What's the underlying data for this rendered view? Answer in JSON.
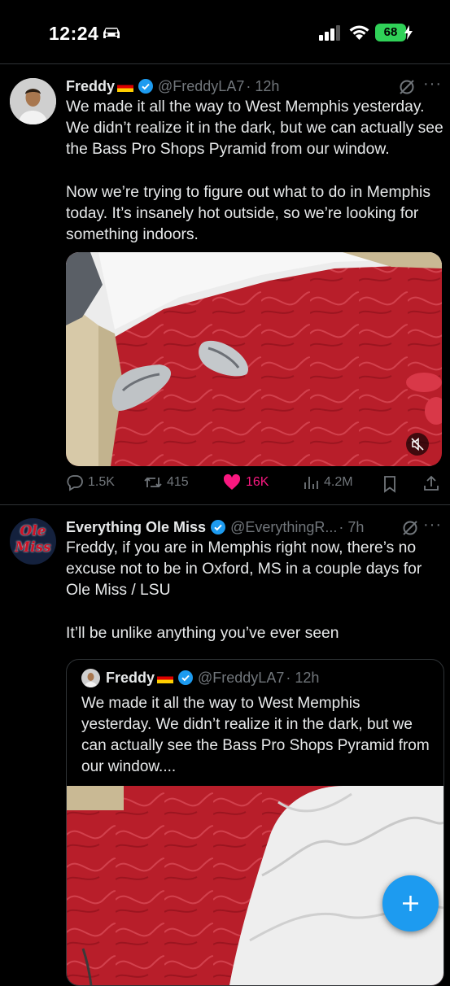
{
  "status_bar": {
    "time": "12:24",
    "battery": "68",
    "icons": [
      "car-icon",
      "cellular-signal-icon",
      "wifi-icon",
      "charging-bolt-icon"
    ]
  },
  "tweets": [
    {
      "name": "Freddy",
      "handle": "@FreddyLA7",
      "time": "· 12h",
      "text": "We made it all the way to West Memphis yesterday. We didn’t realize it in the dark, but we can actually see the Bass Pro Shops Pyramid from our window.\n\nNow we’re trying to figure out what to do in Memphis today. It’s insanely hot outside, so we’re looking for something indoors.",
      "media_icon": "muted-speaker-icon",
      "stats": {
        "replies": "1.5K",
        "reposts": "415",
        "likes": "16K",
        "views": "4.2M"
      }
    },
    {
      "name": "Everything Ole Miss",
      "handle": "@EverythingR...",
      "time": "· 7h",
      "text": "Freddy, if you are in Memphis right now, there’s no excuse not to be in Oxford, MS in a couple days for Ole Miss / LSU\n\nIt’ll be unlike anything you’ve ever seen",
      "avatar_text_1": "Ole",
      "avatar_text_2": "Miss",
      "quote": {
        "name": "Freddy",
        "handle": "@FreddyLA7",
        "time": "· 12h",
        "text": "We made it all the way to West Memphis yesterday. We didn’t realize it in the dark, but we can actually see the Bass Pro Shops Pyramid from our window...."
      }
    }
  ],
  "fab": {
    "label": "+"
  },
  "colors": {
    "accent": "#1d9bf0",
    "like": "#f91880",
    "muted": "#71767b",
    "background": "#000000"
  }
}
